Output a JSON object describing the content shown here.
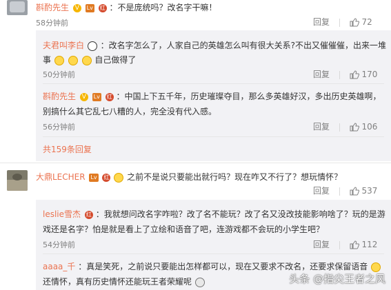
{
  "comments": [
    {
      "name": "斟酌先生",
      "text": "：不是庞统吗？改名字干嘛！",
      "time": "58分钟前",
      "reply_label": "回复",
      "likes": "72"
    },
    {
      "name": "夫君叫李白",
      "text_line1": "：改名字怎么了，人家自己的英雄怎么叫有很大关系?不出又催催催，出来一堆",
      "text_line2a": "事",
      "text_line2b": "自己做得了",
      "time": "50分钟前",
      "reply_label": "回复",
      "likes": "170"
    },
    {
      "name": "斟酌先生",
      "text_line1": "：中国上下五千年，历史璀璨夺目，那么多英雄好汉，多出历史英雄啊，",
      "text_line2": "别搞什么其它乱七八糟的人，完全没有代入感。",
      "time": "56分钟前",
      "reply_label": "回复",
      "likes": "106"
    }
  ],
  "expand_replies": "共159条回复",
  "comments2": [
    {
      "name": "大鼎LECHER",
      "text": "之前不是说只要能出就行吗？现在咋又不行了？想玩情怀？",
      "reply_label": "回复",
      "likes": "537"
    },
    {
      "name": "leslie雪杰",
      "text_line1": "：我就想问改名字咋啦？改了名不能玩？改了名又没改技能影响啥了？玩的是游",
      "text_line2": "戏还是名字？怕是就是看上了立绘和语音了吧，连游戏都不会玩的小学生吧？",
      "time": "54分钟前",
      "reply_label": "回复",
      "likes": "112"
    },
    {
      "name": "aaaa_千",
      "text_line1": "：真是笑死，之前说只要能出怎样都可以，现在又要求不改名，还要求保留语音",
      "text_line2": "还情怀，真有历史情怀还能玩王者荣耀呢"
    }
  ],
  "badges": {
    "v": "V",
    "grade_label": "Lv",
    "circle_label": "红"
  },
  "watermark": "头条 @指尖王者之风",
  "icons": [
    "thumbs-up-icon",
    "verified-v-icon",
    "member-badge-icon",
    "emoji-icon"
  ],
  "colors": {
    "name": "#eb7350",
    "reply_bg": "#f2f2f5",
    "time": "#808080"
  }
}
